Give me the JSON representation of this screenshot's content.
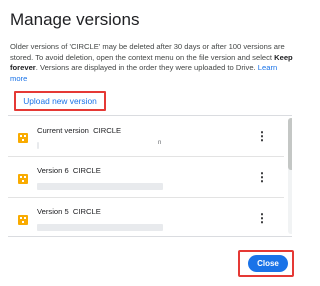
{
  "dialog": {
    "title": "Manage versions",
    "description": {
      "part1": "Older versions of 'CIRCLE' may be deleted after 30 days or after 100 versions are stored. To avoid deletion, open the context menu on the file version and select ",
      "bold": "Keep forever",
      "part2": ". Versions are displayed in the order they were uploaded to Drive. ",
      "link": "Learn more"
    },
    "upload_button": "Upload new version",
    "close_button": "Close"
  },
  "versions": [
    {
      "label": "Current version",
      "file": "CIRCLE",
      "meta_fragment": "n",
      "icon": "file-icon"
    },
    {
      "label": "Version 6",
      "file": "CIRCLE",
      "icon": "file-icon"
    },
    {
      "label": "Version 5",
      "file": "CIRCLE",
      "icon": "file-icon"
    }
  ],
  "colors": {
    "accent": "#1a73e8",
    "highlight": "#e53935",
    "file_icon": "#f9ab00"
  }
}
